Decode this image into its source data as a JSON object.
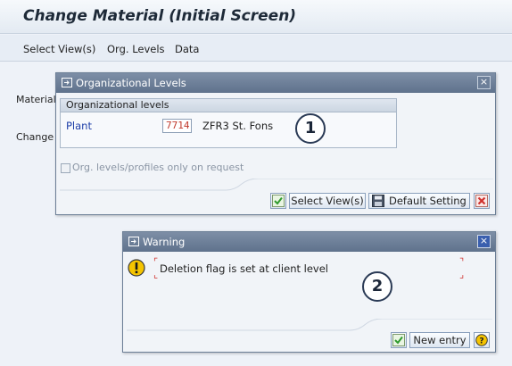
{
  "window": {
    "title": "Change Material (Initial Screen)",
    "menu": [
      "Select View(s)",
      "Org. Levels",
      "Data"
    ],
    "background_labels": [
      "Material",
      "Change I"
    ]
  },
  "org_dialog": {
    "title": "Organizational Levels",
    "group_header": "Organizational levels",
    "plant_label": "Plant",
    "plant_value": "7714",
    "plant_description": "ZFR3 St. Fons",
    "checkbox_label": "Org. levels/profiles only on request",
    "checkbox_checked": false,
    "buttons": {
      "confirm_icon": "checkmark-icon",
      "select_views": "Select View(s)",
      "save_icon": "floppy-disk-icon",
      "default_setting": "Default Setting",
      "cancel_icon": "cancel-x-icon"
    },
    "callout": "1"
  },
  "warning_dialog": {
    "title": "Warning",
    "icon": "warning-icon",
    "message": "Deletion flag is set at client level",
    "buttons": {
      "confirm_icon": "checkmark-icon",
      "new_entry": "New entry",
      "help_icon": "help-icon"
    },
    "callout": "2"
  },
  "colors": {
    "title_bar_dialog": "#6d7f99",
    "field_label": "#1e3fa8",
    "input_value": "#c0392b",
    "warning_yellow": "#f5c400",
    "confirm_green": "#2e9a2e",
    "cancel_red": "#d0312d"
  }
}
